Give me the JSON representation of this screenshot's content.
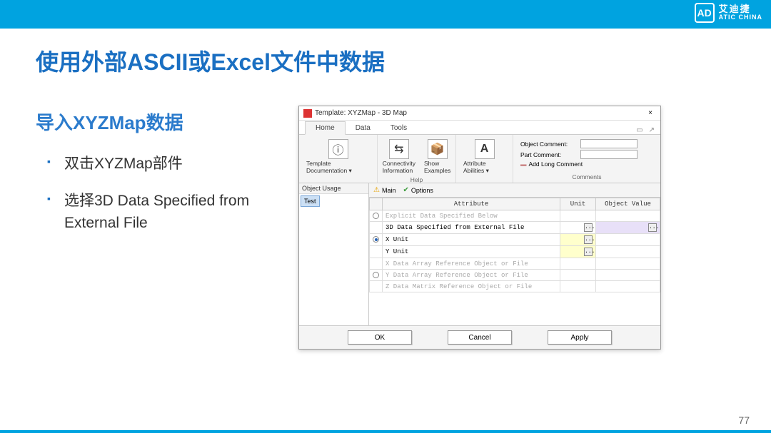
{
  "slide": {
    "title": "使用外部ASCII或Excel文件中数据",
    "subtitle": "导入XYZMap数据",
    "bullets": [
      "双击XYZMap部件",
      "选择3D Data Specified from External File"
    ],
    "page_num": "77",
    "logo_cn": "艾迪捷",
    "logo_en": "ATIC CHINA",
    "logo_mark": "AD"
  },
  "dialog": {
    "title": "Template: XYZMap - 3D Map",
    "close": "×",
    "tabs": [
      "Home",
      "Data",
      "Tools"
    ],
    "ribbon": {
      "group1": {
        "label": "",
        "btn1": "Template Documentation",
        "btn1_arrow": "▾"
      },
      "help": {
        "label": "Help",
        "btn1": "Connectivity Information",
        "btn2": "Show Examples"
      },
      "attr": {
        "label": "",
        "btn1": "Attribute Abilities",
        "btn1_arrow": "▾"
      },
      "comments": {
        "label": "Comments",
        "obj": "Object Comment:",
        "part": "Part Comment:",
        "add_icon": "▬",
        "add": "Add Long Comment"
      }
    },
    "usage": {
      "header": "Object Usage",
      "item": "Test"
    },
    "subtabs": {
      "main": "Main",
      "options": "Options"
    },
    "table": {
      "headers": {
        "attr": "Attribute",
        "unit": "Unit",
        "value": "Object Value"
      },
      "rows": [
        {
          "radio": false,
          "attr": "Explicit Data Specified Below",
          "disabled": true
        },
        {
          "radio": null,
          "attr": "3D Data Specified from External File",
          "unit_btn": "...",
          "value_hl": true,
          "value_btn": "..."
        },
        {
          "radio": true,
          "attr": "X Unit",
          "unit_btn": "...",
          "unit_hl": true
        },
        {
          "radio": null,
          "attr": "Y Unit",
          "unit_btn": "...",
          "unit_hl": true
        },
        {
          "radio": null,
          "attr": "X Data Array Reference Object or File",
          "disabled": true
        },
        {
          "radio": false,
          "attr": "Y Data Array Reference Object or File",
          "disabled": true
        },
        {
          "radio": null,
          "attr": "Z Data Matrix Reference Object or File",
          "disabled": true
        }
      ]
    },
    "buttons": {
      "ok": "OK",
      "cancel": "Cancel",
      "apply": "Apply"
    }
  }
}
